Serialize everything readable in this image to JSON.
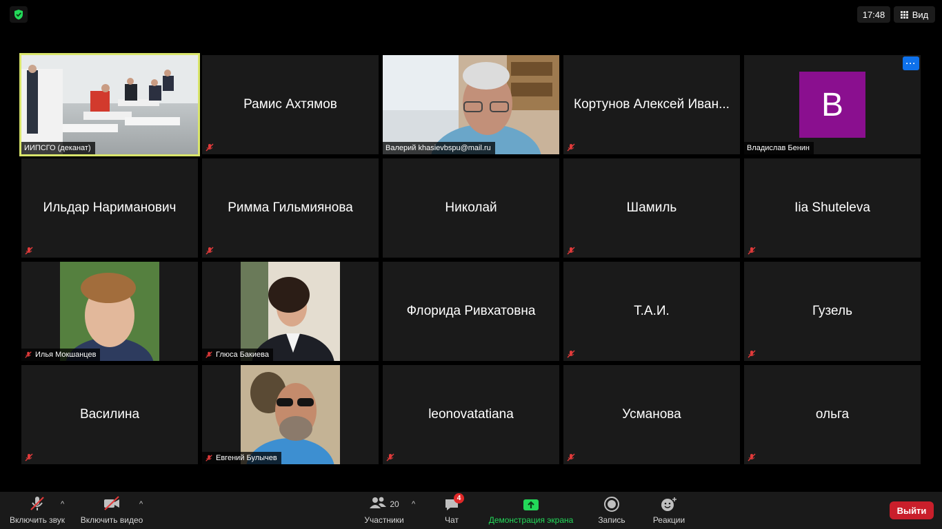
{
  "top": {
    "clock": "17:48",
    "view_label": "Вид",
    "accent": "#d9e56b"
  },
  "tiles": [
    {
      "name": "ИИПСГО (деканат)",
      "type": "video"
    },
    {
      "name": "Рамис Ахтямов",
      "type": "name"
    },
    {
      "name": "Валерий khasievbspu@mail.ru",
      "type": "video"
    },
    {
      "name": "Кортунов Алексей Иван...",
      "type": "name"
    },
    {
      "name": "Владислав Бенин",
      "type": "avatar",
      "avatar_letter": "B",
      "avatar_color": "#8a0f8f"
    },
    {
      "name": "Ильдар Нариманович",
      "type": "name"
    },
    {
      "name": "Римма Гильмиянова",
      "type": "name"
    },
    {
      "name": "Николай",
      "type": "name"
    },
    {
      "name": "Шамиль",
      "type": "name"
    },
    {
      "name": "Iia Shuteleva",
      "type": "name"
    },
    {
      "name": "Илья Мокшанцев",
      "type": "video"
    },
    {
      "name": "Глюса Бакиева",
      "type": "video"
    },
    {
      "name": "Флорида Ривхатовна",
      "type": "name"
    },
    {
      "name": "Т.А.И.",
      "type": "name"
    },
    {
      "name": "Гузель",
      "type": "name"
    },
    {
      "name": "Василина",
      "type": "name"
    },
    {
      "name": "Евгений Булычев",
      "type": "video"
    },
    {
      "name": "leonovatatiana",
      "type": "name"
    },
    {
      "name": "Усманова",
      "type": "name"
    },
    {
      "name": "ольга",
      "type": "name"
    }
  ],
  "more_label": "···",
  "toolbar": {
    "unmute": "Включить звук",
    "start_video": "Включить видео",
    "participants": "Участники",
    "participants_count": "20",
    "chat": "Чат",
    "chat_badge": "4",
    "share": "Демонстрация экрана",
    "record": "Запись",
    "reactions": "Реакции",
    "leave": "Выйти",
    "share_color": "#23d959",
    "leave_color": "#c91f2b"
  }
}
